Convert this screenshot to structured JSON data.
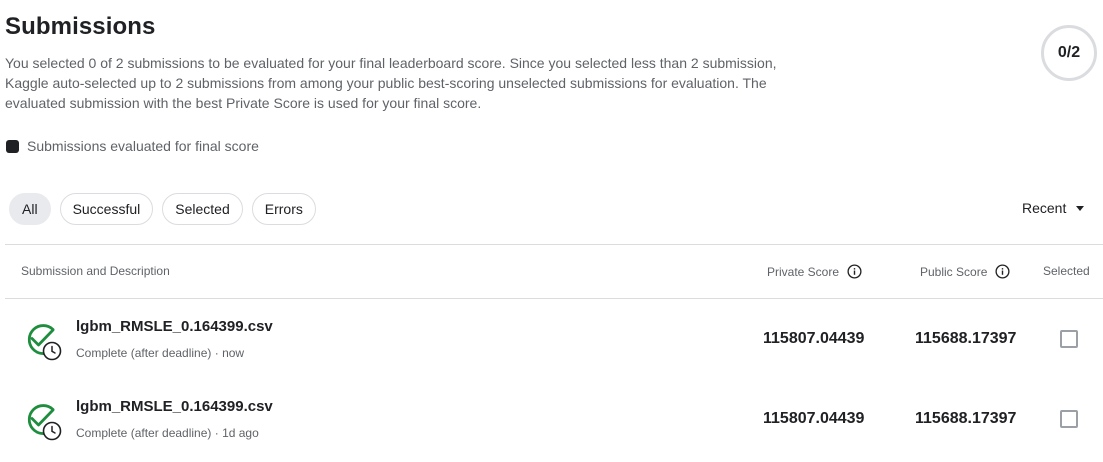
{
  "header": {
    "title": "Submissions",
    "description": "You selected 0 of 2 submissions to be evaluated for your final leaderboard score. Since you selected less than 2 submission, Kaggle auto-selected up to 2 submissions from among your public best-scoring unselected submissions for evaluation. The evaluated submission with the best Private Score is used for your final score.",
    "selection_counter": "0/2"
  },
  "legend": {
    "label": "Submissions evaluated for final score",
    "swatch_color": "#202124"
  },
  "filters": {
    "chips": [
      {
        "label": "All",
        "active": true
      },
      {
        "label": "Successful",
        "active": false
      },
      {
        "label": "Selected",
        "active": false
      },
      {
        "label": "Errors",
        "active": false
      }
    ],
    "sort_label": "Recent",
    "sort_icon": "caret-down-icon"
  },
  "table": {
    "columns": {
      "submission": "Submission and Description",
      "private": "Private Score",
      "public": "Public Score",
      "selected": "Selected"
    },
    "info_icon": "info-circle-icon",
    "rows": [
      {
        "name": "lgbm_RMSLE_0.164399.csv",
        "status": "Complete (after deadline) · now",
        "private_score": "115807.04439",
        "public_score": "115688.17397",
        "selected": false,
        "status_icon": "check-circle-clock-icon",
        "status_color": "#1e8e3e"
      },
      {
        "name": "lgbm_RMSLE_0.164399.csv",
        "status": "Complete (after deadline) · 1d ago",
        "private_score": "115807.04439",
        "public_score": "115688.17397",
        "selected": false,
        "status_icon": "check-circle-clock-icon",
        "status_color": "#1e8e3e"
      }
    ]
  }
}
